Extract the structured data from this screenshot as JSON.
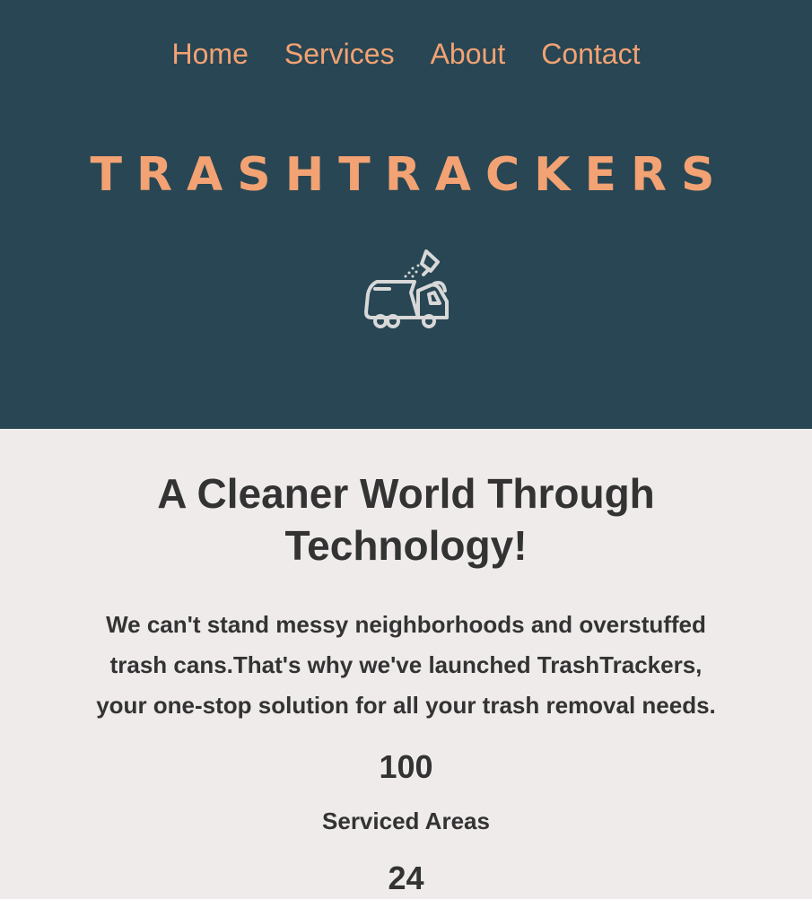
{
  "nav": {
    "items": [
      {
        "label": "Home"
      },
      {
        "label": "Services"
      },
      {
        "label": "About"
      },
      {
        "label": "Contact"
      }
    ]
  },
  "hero": {
    "brand": "TRASHTRACKERS",
    "icon": "garbage-truck-icon"
  },
  "main": {
    "headline": "A Cleaner World Through Technology!",
    "intro": "We can't stand messy neighborhoods and overstuffed trash cans.That's why we've launched TrashTrackers, your one-stop solution for all your trash removal needs.",
    "stats": [
      {
        "number": "100",
        "label": "Serviced Areas"
      },
      {
        "number": "24",
        "label": ""
      }
    ]
  },
  "colors": {
    "hero_bg": "#284654",
    "accent": "#f2a273",
    "page_bg": "#efebea",
    "text": "#333333",
    "icon_stroke": "#d8d8d8"
  }
}
